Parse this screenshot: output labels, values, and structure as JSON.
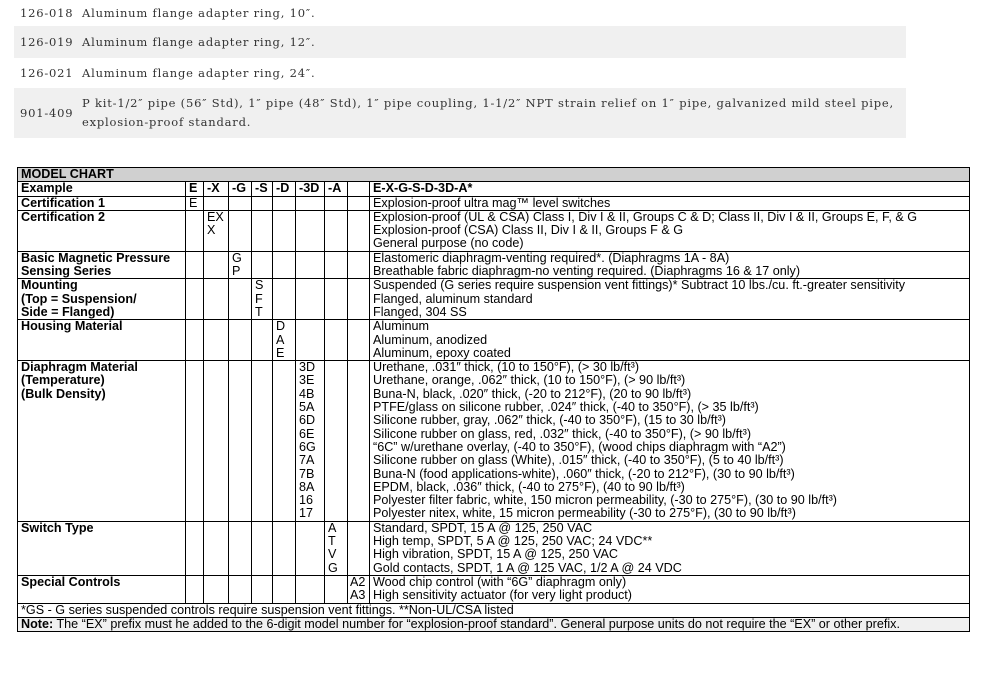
{
  "parts": [
    {
      "code": "126-018",
      "desc": "Aluminum flange adapter ring, 10″."
    },
    {
      "code": "126-019",
      "desc": "Aluminum flange adapter ring, 12″."
    },
    {
      "code": "126-021",
      "desc": "Aluminum flange adapter ring, 24″."
    },
    {
      "code": "901-409",
      "desc": "P kit-1/2″ pipe (56″ Std), 1″ pipe (48″ Std), 1″ pipe coupling, 1-1/2″ NPT strain relief on 1″ pipe, galvanized mild steel pipe, explosion-proof standard."
    }
  ],
  "chart": {
    "title": "MODEL CHART",
    "example": {
      "label": "Example",
      "cols": [
        "E",
        "-X",
        "-G",
        "-S",
        "-D",
        "-3D",
        "-A",
        ""
      ],
      "value": "E-X-G-S-D-3D-A*"
    },
    "cert1": {
      "label": "Certification 1",
      "code": "E",
      "desc": "Explosion-proof ultra mag™ level switches"
    },
    "cert2": {
      "label": "Certification 2",
      "codes": "EX\nX",
      "desc": [
        "Explosion-proof (UL & CSA) Class I, Div I & II, Groups C & D; Class II, Div I & II, Groups E, F, & G",
        "Explosion-proof (CSA) Class II, Div I & II, Groups F & G",
        "General purpose (no code)"
      ]
    },
    "basic": {
      "label": [
        "Basic Magnetic Pressure",
        "Sensing Series"
      ],
      "codes": [
        "G",
        "P"
      ],
      "desc": [
        "Elastomeric diaphragm-venting required*. (Diaphragms 1A - 8A)",
        "Breathable fabric diaphragm-no venting required. (Diaphragms 16 & 17 only)"
      ]
    },
    "mounting": {
      "label": [
        "Mounting",
        "(Top = Suspension/",
        "Side = Flanged)"
      ],
      "codes": [
        "S",
        "F",
        "T"
      ],
      "desc": [
        "Suspended (G series require suspension vent fittings)* Subtract 10 lbs./cu. ft.-greater sensitivity",
        "Flanged, aluminum standard",
        "Flanged, 304 SS"
      ]
    },
    "housing": {
      "label": "Housing Material",
      "codes": [
        "D",
        "A",
        "E"
      ],
      "desc": [
        "Aluminum",
        "Aluminum, anodized",
        "Aluminum, epoxy coated"
      ]
    },
    "diaphragm": {
      "label": [
        "Diaphragm Material",
        "(Temperature)",
        "(Bulk Density)"
      ],
      "codes": [
        "3D",
        "3E",
        "4B",
        "5A",
        "6D",
        "6E",
        "6G",
        "7A",
        "7B",
        "8A",
        "16",
        "17"
      ],
      "desc": [
        "Urethane, .031″ thick, (10 to 150°F), (> 30 lb/ft³)",
        "Urethane, orange, .062″ thick, (10 to 150°F), (> 90 lb/ft³)",
        "Buna-N, black, .020″ thick, (-20 to 212°F), (20 to 90 lb/ft³)",
        "PTFE/glass on silicone rubber, .024″ thick, (-40 to 350°F), (> 35 lb/ft³)",
        "Silicone rubber, gray, .062″ thick, (-40 to 350°F), (15 to 30 lb/ft³)",
        "Silicone rubber on glass, red, .032″ thick, (-40 to 350°F), (> 90 lb/ft³)",
        "“6C” w/urethane overlay, (-40 to 350°F), (wood chips diaphragm with “A2”)",
        "Silicone rubber on glass (White), .015″ thick, (-40 to 350°F), (5 to 40 lb/ft³)",
        "Buna-N (food applications-white), .060″ thick, (-20 to 212°F), (30 to 90 lb/ft³)",
        "EPDM, black, .036″ thick, (-40 to 275°F), (40 to 90 lb/ft³)",
        "Polyester filter fabric, white, 150 micron permeability, (-30 to 275°F), (30 to 90 lb/ft³)",
        "Polyester nitex, white, 15 micron permeability (-30 to 275°F), (30 to 90 lb/ft³)"
      ]
    },
    "switch": {
      "label": "Switch Type",
      "codes": [
        "A",
        "T",
        "V",
        "G"
      ],
      "desc": [
        "Standard, SPDT, 15 A @ 125, 250 VAC",
        "High temp, SPDT, 5 A @ 125, 250 VAC; 24 VDC**",
        "High vibration, SPDT, 15 A @ 125, 250 VAC",
        "Gold contacts, SPDT, 1 A @ 125 VAC, 1/2 A @ 24 VDC"
      ]
    },
    "special": {
      "label": "Special Controls",
      "codes": [
        "A2",
        "A3"
      ],
      "desc": [
        "Wood chip control (with “6G” diaphragm only)",
        "High sensitivity actuator (for very light product)"
      ]
    },
    "footnote": "*GS - G series suspended controls require suspension vent fittings. **Non-UL/CSA listed",
    "note_label": "Note:",
    "note": " The “EX” prefix must he added to the 6-digit model number for “explosion-proof standard”. General purpose units do not require the “EX” or other prefix."
  }
}
